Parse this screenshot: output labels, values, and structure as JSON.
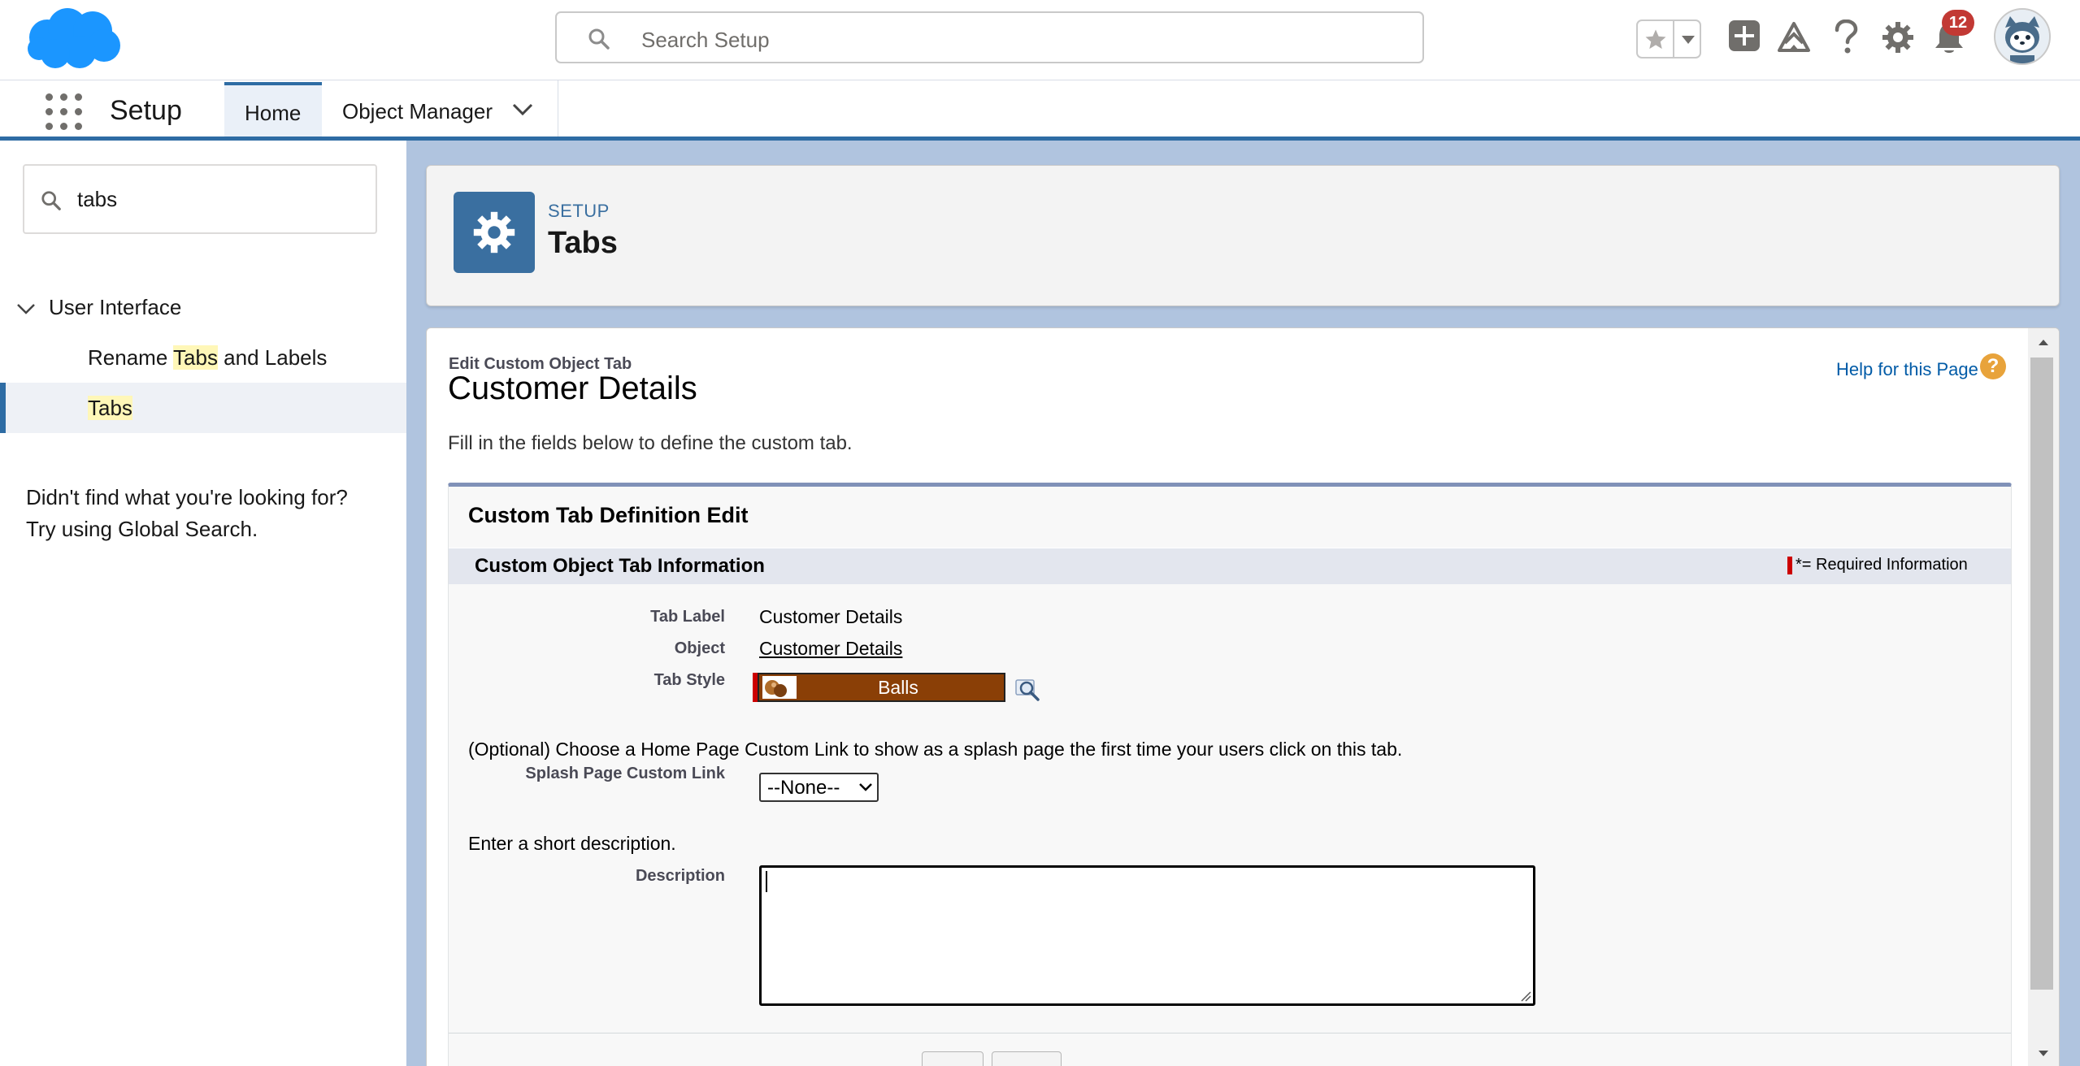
{
  "header": {
    "search_placeholder": "Search Setup",
    "notification_count": "12",
    "brand_color": "#1b96ff",
    "icons": [
      "favorites-star-icon",
      "favorites-list-chevron-icon",
      "global-actions-plus-icon",
      "trailhead-icon",
      "help-icon",
      "setup-gear-icon",
      "notifications-bell-icon",
      "user-avatar-icon"
    ]
  },
  "context_nav": {
    "app_name": "Setup",
    "tabs": [
      {
        "label": "Home",
        "active": true
      },
      {
        "label": "Object Manager",
        "has_menu": true
      }
    ]
  },
  "sidebar": {
    "quick_find_value": "tabs",
    "tree": {
      "group_label": "User Interface",
      "items": [
        {
          "pre": "Rename ",
          "match": "Tabs",
          "post": " and Labels"
        },
        {
          "match": "Tabs",
          "selected": true
        }
      ]
    },
    "not_found_line1": "Didn't find what you're looking for?",
    "not_found_line2": "Try using Global Search."
  },
  "page_header": {
    "eyebrow": "SETUP",
    "title": "Tabs"
  },
  "content": {
    "eyebrow": "Edit Custom Object Tab",
    "title": "Customer Details",
    "help_link": "Help for this Page",
    "help_icon_glyph": "?",
    "intro": "Fill in the fields below to define the custom tab.",
    "block_title": "Custom Tab Definition Edit",
    "section_title": "Custom Object Tab Information",
    "required_legend": "= Required Information",
    "required_marker": "*",
    "fields": {
      "tab_label": {
        "label": "Tab Label",
        "value": "Customer Details"
      },
      "object": {
        "label": "Object",
        "value": "Customer Details"
      },
      "tab_style": {
        "label": "Tab Style",
        "value": "Balls",
        "color": "#8a3f06"
      },
      "splash_note": "(Optional) Choose a Home Page Custom Link to show as a splash page the first time your users click on this tab.",
      "splash_link": {
        "label": "Splash Page Custom Link",
        "value": "--None--"
      },
      "description_note": "Enter a short description.",
      "description": {
        "label": "Description",
        "value": ""
      }
    }
  }
}
